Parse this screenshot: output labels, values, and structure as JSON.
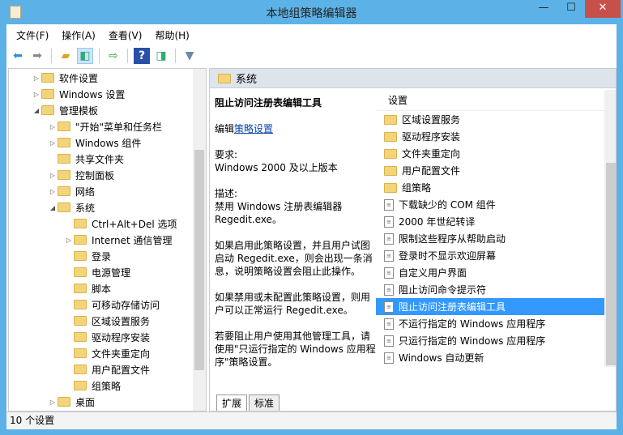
{
  "window": {
    "title": "本地组策略编辑器",
    "min": "—",
    "max": "☐",
    "close": "✕"
  },
  "menu": [
    "文件(F)",
    "操作(A)",
    "查看(V)",
    "帮助(H)"
  ],
  "tree": [
    {
      "label": "软件设置",
      "level": 1,
      "arrow": "▷"
    },
    {
      "label": "Windows 设置",
      "level": 1,
      "arrow": "▷"
    },
    {
      "label": "管理模板",
      "level": 1,
      "arrow": "◢"
    },
    {
      "label": "\"开始\"菜单和任务栏",
      "level": 2,
      "arrow": "▷"
    },
    {
      "label": "Windows 组件",
      "level": 2,
      "arrow": "▷"
    },
    {
      "label": "共享文件夹",
      "level": 2,
      "arrow": ""
    },
    {
      "label": "控制面板",
      "level": 2,
      "arrow": "▷"
    },
    {
      "label": "网络",
      "level": 2,
      "arrow": "▷"
    },
    {
      "label": "系统",
      "level": 2,
      "arrow": "◢"
    },
    {
      "label": "Ctrl+Alt+Del 选项",
      "level": 3,
      "arrow": ""
    },
    {
      "label": "Internet 通信管理",
      "level": 3,
      "arrow": "▷"
    },
    {
      "label": "登录",
      "level": 3,
      "arrow": ""
    },
    {
      "label": "电源管理",
      "level": 3,
      "arrow": ""
    },
    {
      "label": "脚本",
      "level": 3,
      "arrow": ""
    },
    {
      "label": "可移动存储访问",
      "level": 3,
      "arrow": ""
    },
    {
      "label": "区域设置服务",
      "level": 3,
      "arrow": ""
    },
    {
      "label": "驱动程序安装",
      "level": 3,
      "arrow": ""
    },
    {
      "label": "文件夹重定向",
      "level": 3,
      "arrow": ""
    },
    {
      "label": "用户配置文件",
      "level": 3,
      "arrow": ""
    },
    {
      "label": "组策略",
      "level": 3,
      "arrow": ""
    },
    {
      "label": "桌面",
      "level": 2,
      "arrow": "▷"
    }
  ],
  "right": {
    "header": "系统",
    "desc": {
      "title": "阻止访问注册表编辑工具",
      "edit_prefix": "编辑",
      "edit_link": "策略设置",
      "req_label": "要求:",
      "req": "Windows 2000 及以上版本",
      "desc_label": "描述:",
      "desc": "禁用 Windows 注册表编辑器 Regedit.exe。",
      "p1": "如果启用此策略设置，并且用户试图启动 Regedit.exe，则会出现一条消息，说明策略设置会阻止此操作。",
      "p2": "如果禁用或未配置此策略设置，则用户可以正常运行 Regedit.exe。",
      "p3": "若要阻止用户使用其他管理工具，请使用\"只运行指定的 Windows 应用程序\"策略设置。"
    },
    "list_header": "设置",
    "items": [
      {
        "label": "区域设置服务",
        "type": "folder"
      },
      {
        "label": "驱动程序安装",
        "type": "folder"
      },
      {
        "label": "文件夹重定向",
        "type": "folder"
      },
      {
        "label": "用户配置文件",
        "type": "folder"
      },
      {
        "label": "组策略",
        "type": "folder"
      },
      {
        "label": "下载缺少的 COM 组件",
        "type": "policy"
      },
      {
        "label": "2000 年世纪转译",
        "type": "policy"
      },
      {
        "label": "限制这些程序从帮助启动",
        "type": "policy"
      },
      {
        "label": "登录时不显示欢迎屏幕",
        "type": "policy"
      },
      {
        "label": "自定义用户界面",
        "type": "policy"
      },
      {
        "label": "阻止访问命令提示符",
        "type": "policy"
      },
      {
        "label": "阻止访问注册表编辑工具",
        "type": "policy",
        "selected": true
      },
      {
        "label": "不运行指定的 Windows 应用程序",
        "type": "policy"
      },
      {
        "label": "只运行指定的 Windows 应用程序",
        "type": "policy"
      },
      {
        "label": "Windows 自动更新",
        "type": "policy"
      }
    ],
    "tabs": [
      "扩展",
      "标准"
    ]
  },
  "status": "10 个设置"
}
